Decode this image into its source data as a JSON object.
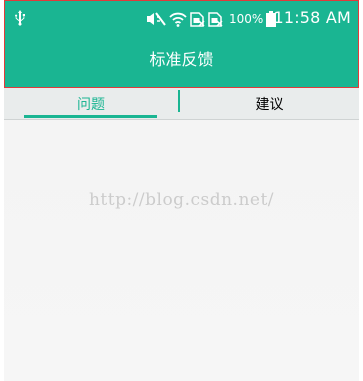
{
  "status_bar": {
    "battery_percent": "100%",
    "time": "11:58 AM",
    "icons": [
      "usb-icon",
      "mute-icon",
      "wifi-icon",
      "sim-1-no-service-icon",
      "sim-2-no-service-icon",
      "battery-full-icon"
    ]
  },
  "app_bar": {
    "title": "标准反馈"
  },
  "tabs": [
    {
      "label": "问题",
      "selected": true
    },
    {
      "label": "建议",
      "selected": false
    }
  ],
  "watermark": "http://blog.csdn.net/",
  "colors": {
    "accent": "#1ab592",
    "highlight_box": "#e13b3b",
    "tab_background": "#e9ecec",
    "content_background": "#f3f3f3"
  }
}
